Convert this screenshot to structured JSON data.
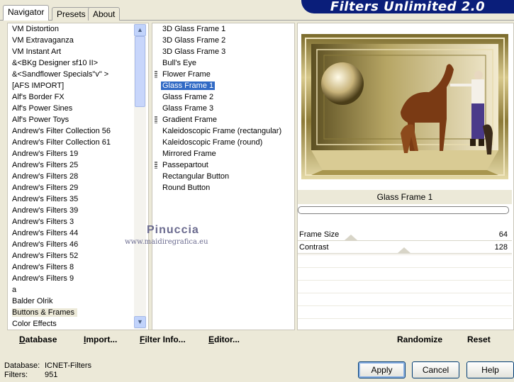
{
  "banner": {
    "title": "Filters Unlimited 2.0"
  },
  "tabs": [
    {
      "label": "Navigator",
      "active": true
    },
    {
      "label": "Presets",
      "active": false
    },
    {
      "label": "About",
      "active": false
    }
  ],
  "categories": {
    "items": [
      "VM Distortion",
      "VM Extravaganza",
      "VM Instant Art",
      "&<BKg Designer sf10 II>",
      "&<Sandflower Specials\"v\" >",
      "[AFS IMPORT]",
      "Alf's Border FX",
      "Alf's Power Sines",
      "Alf's Power Toys",
      "Andrew's Filter Collection 56",
      "Andrew's Filter Collection 61",
      "Andrew's Filters 19",
      "Andrew's Filters 25",
      "Andrew's Filters 28",
      "Andrew's Filters 29",
      "Andrew's Filters 35",
      "Andrew's Filters 39",
      "Andrew's Filters 3",
      "Andrew's Filters 44",
      "Andrew's Filters 46",
      "Andrew's Filters 52",
      "Andrew's Filters 8",
      "Andrew's Filters 9",
      "a",
      "Balder Olrik",
      "Buttons & Frames",
      "Color Effects"
    ],
    "selected": "Buttons & Frames",
    "scroll_up": "▲",
    "scroll_down": "▼"
  },
  "filters": {
    "items": [
      {
        "label": "3D Glass Frame 1",
        "grip": false
      },
      {
        "label": "3D Glass Frame 2",
        "grip": false
      },
      {
        "label": "3D Glass Frame 3",
        "grip": false
      },
      {
        "label": "Bull's Eye",
        "grip": false
      },
      {
        "label": "Flower Frame",
        "grip": true
      },
      {
        "label": "Glass Frame 1",
        "grip": false
      },
      {
        "label": "Glass Frame 2",
        "grip": false
      },
      {
        "label": "Glass Frame 3",
        "grip": false
      },
      {
        "label": "Gradient Frame",
        "grip": true
      },
      {
        "label": "Kaleidoscopic Frame (rectangular)",
        "grip": false
      },
      {
        "label": "Kaleidoscopic Frame (round)",
        "grip": false
      },
      {
        "label": "Mirrored Frame",
        "grip": false
      },
      {
        "label": "Passepartout",
        "grip": true
      },
      {
        "label": "Rectangular Button",
        "grip": false
      },
      {
        "label": "Round Button",
        "grip": false
      }
    ],
    "selected": "Glass Frame 1"
  },
  "left_buttons": [
    {
      "label": "Database",
      "u": "D"
    },
    {
      "label": "Import...",
      "u": "I"
    },
    {
      "label": "Filter Info...",
      "u": "F"
    },
    {
      "label": "Editor...",
      "u": "E"
    }
  ],
  "preview": {
    "filter_name": "Glass Frame 1",
    "params": [
      {
        "name": "Frame Size",
        "value": "64"
      },
      {
        "name": "Contrast",
        "value": "128"
      }
    ]
  },
  "right_buttons": {
    "randomize": "Randomize",
    "reset": "Reset"
  },
  "watermark": {
    "line1": "Pinuccia",
    "line2": "www.maidiregrafica.eu"
  },
  "status": {
    "database_label": "Database:",
    "database_value": "ICNET-Filters",
    "filters_label": "Filters:",
    "filters_value": "951"
  },
  "dialog": {
    "apply": "Apply",
    "cancel": "Cancel",
    "help": "Help"
  },
  "colors": {
    "selection": "#316ac5",
    "banner": "#0a1e7a",
    "frame_gold": "#b8a35a"
  }
}
